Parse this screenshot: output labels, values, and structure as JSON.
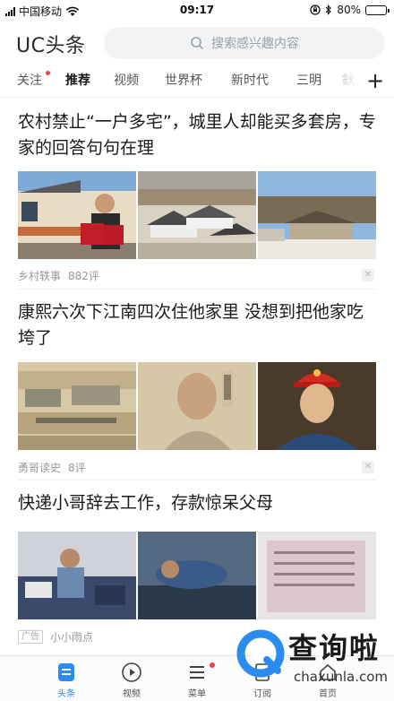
{
  "status": {
    "carrier": "中国移动",
    "time": "09:17",
    "battery": "80%",
    "battery_level": 0.8
  },
  "header": {
    "logo": "UC头条",
    "search_placeholder": "搜索感兴趣内容"
  },
  "tabs": [
    "关注",
    "推荐",
    "视频",
    "世界杯",
    "新时代",
    "三明",
    "鈥"
  ],
  "articles": [
    {
      "title": "农村禁止“一户多宅”，城里人却能买多套房，专家的回答句句在理",
      "source": "乡村轶事",
      "comments": "882评"
    },
    {
      "title": "康熙六次下江南四次住他家里 没想到把他家吃垮了",
      "source": "勇哥读史",
      "comments": "8评"
    },
    {
      "title": "快递小哥辞去工作，存款惊呆父母",
      "ad_label": "广告",
      "source": "小小雨点"
    }
  ],
  "bottom_nav": [
    "头条",
    "视频",
    "菜单",
    "订阅",
    "首页"
  ],
  "watermark": {
    "text": "查询啦",
    "url": "chaxunla.com"
  },
  "colors": {
    "accent": "#2a8cf0",
    "badge": "#f04142"
  }
}
